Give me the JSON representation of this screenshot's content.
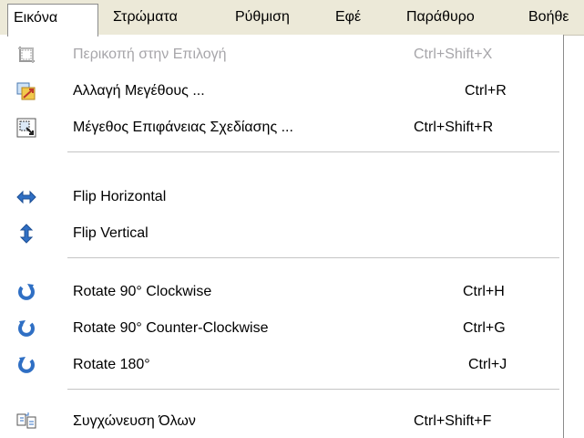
{
  "menubar": {
    "items": [
      {
        "label": "Εικόνα"
      },
      {
        "label": "Στρώματα"
      },
      {
        "label": "Ρύθμιση"
      },
      {
        "label": "Εφέ"
      },
      {
        "label": "Παράθυρο"
      },
      {
        "label": "Βοήθε"
      }
    ]
  },
  "menu": {
    "items": [
      {
        "label": "Περικοπή στην Επιλογή",
        "shortcut": "Ctrl+Shift+X",
        "icon": "crop-to-selection-icon",
        "enabled": false
      },
      {
        "label": "Αλλαγή Μεγέθους ...",
        "shortcut": "Ctrl+R",
        "icon": "resize-image-icon",
        "enabled": true
      },
      {
        "label": "Μέγεθος Επιφάνειας Σχεδίασης ...",
        "shortcut": "Ctrl+Shift+R",
        "icon": "canvas-size-icon",
        "enabled": true
      },
      {
        "label": "Flip Horizontal",
        "shortcut": "",
        "icon": "flip-horizontal-icon",
        "enabled": true
      },
      {
        "label": "Flip Vertical",
        "shortcut": "",
        "icon": "flip-vertical-icon",
        "enabled": true
      },
      {
        "label": "Rotate 90° Clockwise",
        "shortcut": "Ctrl+H",
        "icon": "rotate-clockwise-icon",
        "enabled": true
      },
      {
        "label": "Rotate 90° Counter-Clockwise",
        "shortcut": "Ctrl+G",
        "icon": "rotate-counter-clockwise-icon",
        "enabled": true
      },
      {
        "label": "Rotate 180°",
        "shortcut": "Ctrl+J",
        "icon": "rotate-180-icon",
        "enabled": true
      },
      {
        "label": "Συγχώνευση Όλων",
        "shortcut": "Ctrl+Shift+F",
        "icon": "flatten-icon",
        "enabled": true
      }
    ]
  },
  "colors": {
    "menubar_bg": "#ece9d8",
    "disabled_text": "#a7a6aa",
    "icon_blue": "#2f6fc4"
  }
}
